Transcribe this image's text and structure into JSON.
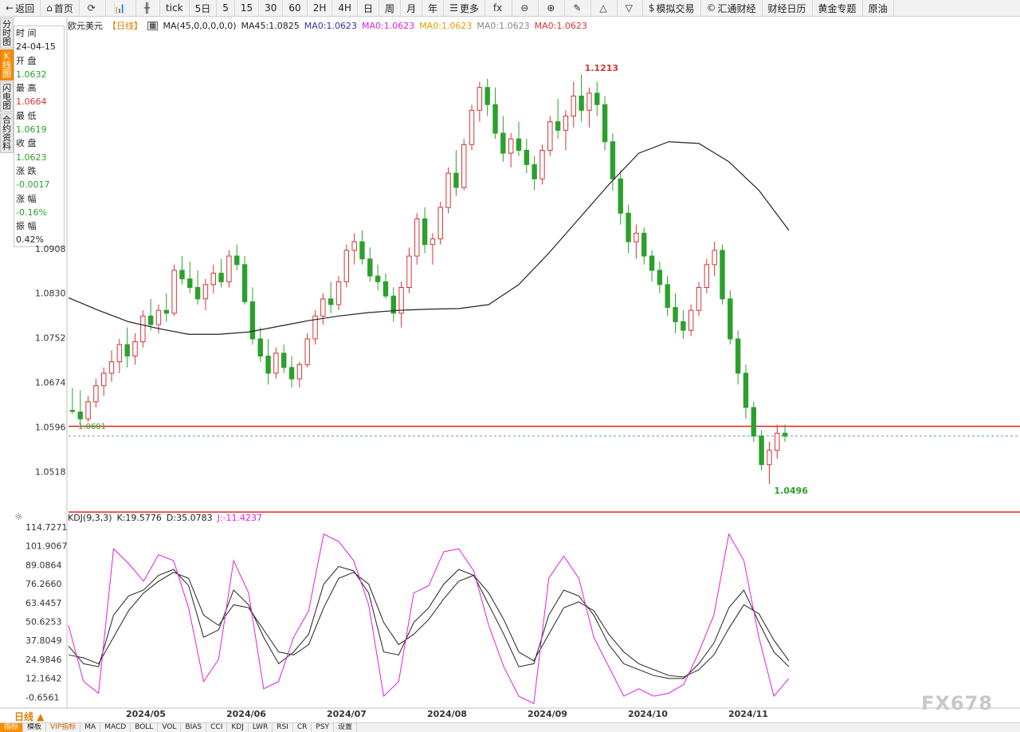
{
  "toolbar": [
    {
      "name": "back-button",
      "icon": "←",
      "label": "返回"
    },
    {
      "name": "home-button",
      "icon": "⌂",
      "label": "首页"
    },
    {
      "name": "refresh-button",
      "icon": "⟳",
      "label": ""
    },
    {
      "name": "chart-type-button",
      "icon": "📊",
      "label": ""
    },
    {
      "name": "candle-type-button",
      "icon": "╫",
      "label": ""
    },
    {
      "name": "period-tick",
      "icon": "",
      "label": "tick"
    },
    {
      "name": "period-5day",
      "icon": "",
      "label": "5日"
    },
    {
      "name": "period-5",
      "icon": "",
      "label": "5"
    },
    {
      "name": "period-15",
      "icon": "",
      "label": "15"
    },
    {
      "name": "period-30",
      "icon": "",
      "label": "30"
    },
    {
      "name": "period-60",
      "icon": "",
      "label": "60"
    },
    {
      "name": "period-2h",
      "icon": "",
      "label": "2H"
    },
    {
      "name": "period-4h",
      "icon": "",
      "label": "4H"
    },
    {
      "name": "period-day",
      "icon": "",
      "label": "日"
    },
    {
      "name": "period-week",
      "icon": "",
      "label": "周"
    },
    {
      "name": "period-month",
      "icon": "",
      "label": "月"
    },
    {
      "name": "period-year",
      "icon": "",
      "label": "年"
    },
    {
      "name": "more-button",
      "icon": "☰",
      "label": "更多"
    },
    {
      "name": "formula-button",
      "icon": "fx",
      "label": ""
    },
    {
      "name": "zoom-out-button",
      "icon": "⊖",
      "label": ""
    },
    {
      "name": "zoom-in-button",
      "icon": "⊕",
      "label": ""
    },
    {
      "name": "draw-button",
      "icon": "✎",
      "label": ""
    },
    {
      "name": "triangle-up-button",
      "icon": "△",
      "label": ""
    },
    {
      "name": "triangle-down-button",
      "icon": "▽",
      "label": ""
    },
    {
      "name": "sim-trade-button",
      "icon": "$",
      "label": "模拟交易"
    },
    {
      "name": "huitong-button",
      "icon": "©",
      "label": "汇通财经"
    },
    {
      "name": "calendar-button",
      "icon": "",
      "label": "财经日历"
    },
    {
      "name": "gold-topic-button",
      "icon": "",
      "label": "黄金专题"
    },
    {
      "name": "crude-button",
      "icon": "",
      "label": "原油"
    }
  ],
  "sidetabs": [
    {
      "name": "tab-timeshare",
      "label": "分时图",
      "active": false
    },
    {
      "name": "tab-kline",
      "label": "K线图",
      "active": true
    },
    {
      "name": "tab-flash",
      "label": "闪电图",
      "active": false
    },
    {
      "name": "tab-contract",
      "label": "合约资料",
      "active": false
    }
  ],
  "info": {
    "time_label": "时 间",
    "time_value": "24-04-15",
    "open_label": "开 盘",
    "open_value": "1.0632",
    "high_label": "最 高",
    "high_value": "1.0664",
    "low_label": "最 低",
    "low_value": "1.0619",
    "close_label": "收 盘",
    "close_value": "1.0623",
    "change_label": "涨 跌",
    "change_value": "-0.0017",
    "pct_label": "涨 幅",
    "pct_value": "-0.16%",
    "amp_label": "振 幅",
    "amp_value": "0.42%"
  },
  "legend": {
    "symbol": "欧元美元",
    "period": "【日线】",
    "ma_params": "MA(45,0,0,0,0,0)",
    "items": [
      {
        "text": "MA45:1.0825",
        "color": "#222222"
      },
      {
        "text": "MA0:1.0623",
        "color": "#3333aa"
      },
      {
        "text": "MA0:1.0623",
        "color": "#e020e0"
      },
      {
        "text": "MA0:1.0623",
        "color": "#e0a000"
      },
      {
        "text": "MA0:1.0623",
        "color": "#888888"
      },
      {
        "text": "MA0:1.0623",
        "color": "#d23535"
      }
    ]
  },
  "kdj_legend": {
    "name": "KDJ(9,3,3)",
    "k": "K:19.5776",
    "d": "D:35.0783",
    "j": "J:-11.4237",
    "k_color": "#222222",
    "d_color": "#222222",
    "j_color": "#e020e0"
  },
  "chart_data": [
    {
      "type": "candlestick",
      "title": "欧元美元 日线",
      "x_labels": [
        "2024/05",
        "2024/06",
        "2024/07",
        "2024/08",
        "2024/09",
        "2024/10",
        "2024/11"
      ],
      "y_ticks": [
        "1.0908",
        "1.0830",
        "1.0752",
        "1.0674",
        "1.0596",
        "1.0518"
      ],
      "ylim": [
        1.045,
        1.129
      ],
      "annotations": {
        "high": "1.1213",
        "low": "1.0496",
        "start_low": "1.0601"
      },
      "hlines": [
        1.0597,
        1.0447
      ],
      "current_price": 1.058,
      "up_color": "#d23535",
      "down_color": "#2ca02c",
      "series": [
        {
          "name": "MA45",
          "values": [
            1.0822,
            1.08,
            1.078,
            1.0768,
            1.0758,
            1.0758,
            1.0762,
            1.0772,
            1.0782,
            1.079,
            1.0796,
            1.08,
            1.0802,
            1.0803,
            1.081,
            1.0845,
            1.09,
            1.096,
            1.102,
            1.1075,
            1.1095,
            1.1092,
            1.106,
            1.101,
            1.094
          ]
        }
      ],
      "ohlc": [
        [
          1.0625,
          1.0664,
          1.0619,
          1.0623
        ],
        [
          1.0622,
          1.066,
          1.06,
          1.061
        ],
        [
          1.061,
          1.065,
          1.0605,
          1.064
        ],
        [
          1.064,
          1.068,
          1.063,
          1.0668
        ],
        [
          1.0668,
          1.07,
          1.065,
          1.069
        ],
        [
          1.069,
          1.073,
          1.0675,
          1.071
        ],
        [
          1.071,
          1.075,
          1.069,
          1.074
        ],
        [
          1.074,
          1.077,
          1.07,
          1.072
        ],
        [
          1.072,
          1.076,
          1.0705,
          1.0745
        ],
        [
          1.0745,
          1.08,
          1.0735,
          1.079
        ],
        [
          1.079,
          1.082,
          1.0765,
          1.0775
        ],
        [
          1.0775,
          1.081,
          1.076,
          1.08
        ],
        [
          1.08,
          1.083,
          1.078,
          1.0795
        ],
        [
          1.0795,
          1.088,
          1.079,
          1.087
        ],
        [
          1.087,
          1.0895,
          1.0845,
          1.0855
        ],
        [
          1.0855,
          1.0885,
          1.083,
          1.084
        ],
        [
          1.084,
          1.087,
          1.081,
          1.082
        ],
        [
          1.082,
          1.0855,
          1.08,
          1.0845
        ],
        [
          1.0845,
          1.088,
          1.083,
          1.0865
        ],
        [
          1.0865,
          1.089,
          1.084,
          1.085
        ],
        [
          1.085,
          1.0905,
          1.084,
          1.0895
        ],
        [
          1.0895,
          1.0915,
          1.087,
          1.088
        ],
        [
          1.088,
          1.0895,
          1.081,
          1.0815
        ],
        [
          1.0815,
          1.084,
          1.074,
          1.075
        ],
        [
          1.075,
          1.077,
          1.071,
          1.072
        ],
        [
          1.072,
          1.075,
          1.067,
          1.069
        ],
        [
          1.069,
          1.0735,
          1.068,
          1.0725
        ],
        [
          1.0725,
          1.074,
          1.069,
          1.07
        ],
        [
          1.07,
          1.072,
          1.0665,
          1.068
        ],
        [
          1.068,
          1.071,
          1.0665,
          1.0705
        ],
        [
          1.0705,
          1.076,
          1.07,
          1.075
        ],
        [
          1.075,
          1.08,
          1.074,
          1.079
        ],
        [
          1.079,
          1.083,
          1.0775,
          1.082
        ],
        [
          1.082,
          1.085,
          1.0795,
          1.081
        ],
        [
          1.081,
          1.086,
          1.08,
          1.085
        ],
        [
          1.085,
          1.0915,
          1.084,
          1.0905
        ],
        [
          1.0905,
          1.0935,
          1.088,
          1.092
        ],
        [
          1.092,
          1.094,
          1.088,
          1.089
        ],
        [
          1.089,
          1.091,
          1.085,
          1.086
        ],
        [
          1.086,
          1.088,
          1.0835,
          1.085
        ],
        [
          1.085,
          1.0865,
          1.082,
          1.0825
        ],
        [
          1.0825,
          1.084,
          1.078,
          1.0795
        ],
        [
          1.0795,
          1.085,
          1.077,
          1.084
        ],
        [
          1.084,
          1.091,
          1.083,
          1.0895
        ],
        [
          1.0895,
          1.097,
          1.088,
          1.096
        ],
        [
          1.096,
          1.098,
          1.09,
          1.0915
        ],
        [
          1.0915,
          1.0935,
          1.088,
          1.0925
        ],
        [
          1.0925,
          1.099,
          1.0915,
          1.098
        ],
        [
          1.098,
          1.105,
          1.097,
          1.104
        ],
        [
          1.104,
          1.108,
          1.1,
          1.1015
        ],
        [
          1.1015,
          1.11,
          1.101,
          1.109
        ],
        [
          1.109,
          1.116,
          1.108,
          1.115
        ],
        [
          1.115,
          1.12,
          1.113,
          1.119
        ],
        [
          1.119,
          1.1205,
          1.114,
          1.116
        ],
        [
          1.116,
          1.119,
          1.11,
          1.111
        ],
        [
          1.111,
          1.114,
          1.106,
          1.1075
        ],
        [
          1.1075,
          1.111,
          1.105,
          1.11
        ],
        [
          1.11,
          1.113,
          1.107,
          1.108
        ],
        [
          1.108,
          1.11,
          1.104,
          1.1055
        ],
        [
          1.1055,
          1.107,
          1.101,
          1.103
        ],
        [
          1.103,
          1.109,
          1.102,
          1.108
        ],
        [
          1.108,
          1.114,
          1.107,
          1.113
        ],
        [
          1.113,
          1.117,
          1.11,
          1.1115
        ],
        [
          1.1115,
          1.115,
          1.108,
          1.114
        ],
        [
          1.114,
          1.12,
          1.112,
          1.1175
        ],
        [
          1.1175,
          1.1213,
          1.113,
          1.115
        ],
        [
          1.115,
          1.119,
          1.112,
          1.118
        ],
        [
          1.118,
          1.12,
          1.114,
          1.116
        ],
        [
          1.116,
          1.1175,
          1.108,
          1.1095
        ],
        [
          1.1095,
          1.111,
          1.101,
          1.103
        ],
        [
          1.103,
          1.1045,
          1.095,
          1.097
        ],
        [
          1.097,
          1.0985,
          1.09,
          1.092
        ],
        [
          1.092,
          1.095,
          1.089,
          1.0935
        ],
        [
          1.0935,
          1.0945,
          1.088,
          1.0895
        ],
        [
          1.0895,
          1.0905,
          1.085,
          1.087
        ],
        [
          1.087,
          1.0885,
          1.083,
          1.0845
        ],
        [
          1.0845,
          1.086,
          1.079,
          1.0805
        ],
        [
          1.0805,
          1.083,
          1.076,
          1.078
        ],
        [
          1.078,
          1.08,
          1.075,
          1.0765
        ],
        [
          1.0765,
          1.081,
          1.0755,
          1.08
        ],
        [
          1.08,
          1.085,
          1.079,
          1.084
        ],
        [
          1.084,
          1.089,
          1.083,
          1.088
        ],
        [
          1.088,
          1.092,
          1.086,
          1.0905
        ],
        [
          1.0905,
          1.0915,
          1.081,
          1.082
        ],
        [
          1.082,
          1.0835,
          1.074,
          1.075
        ],
        [
          1.075,
          1.0765,
          1.067,
          1.069
        ],
        [
          1.069,
          1.0705,
          1.061,
          1.063
        ],
        [
          1.063,
          1.064,
          1.057,
          1.058
        ],
        [
          1.058,
          1.059,
          1.052,
          1.053
        ],
        [
          1.053,
          1.057,
          1.0496,
          1.0555
        ],
        [
          1.0555,
          1.06,
          1.054,
          1.0585
        ],
        [
          1.0585,
          1.06,
          1.057,
          1.058
        ]
      ]
    },
    {
      "type": "line",
      "title": "KDJ(9,3,3)",
      "y_ticks": [
        "114.7271",
        "101.9067",
        "89.0864",
        "76.2660",
        "63.4457",
        "50.6253",
        "37.8049",
        "24.9846",
        "12.1642",
        "-0.6561"
      ],
      "ylim": [
        -7.0,
        118.0
      ],
      "series": [
        {
          "name": "K",
          "values": [
            34,
            22,
            20,
            55,
            68,
            72,
            82,
            86,
            75,
            40,
            45,
            72,
            62,
            40,
            22,
            30,
            42,
            76,
            88,
            85,
            70,
            30,
            28,
            50,
            60,
            76,
            86,
            82,
            62,
            42,
            20,
            22,
            55,
            72,
            68,
            55,
            35,
            22,
            18,
            14,
            12,
            12,
            22,
            36,
            60,
            72,
            50,
            30,
            20
          ]
        },
        {
          "name": "D",
          "values": [
            28,
            26,
            22,
            40,
            58,
            70,
            78,
            84,
            80,
            55,
            48,
            62,
            60,
            45,
            30,
            28,
            35,
            60,
            80,
            84,
            76,
            50,
            35,
            42,
            52,
            66,
            78,
            82,
            70,
            52,
            30,
            24,
            42,
            60,
            64,
            58,
            42,
            30,
            22,
            18,
            14,
            13,
            18,
            28,
            46,
            62,
            56,
            38,
            24
          ]
        },
        {
          "name": "J",
          "values": [
            48,
            10,
            2,
            100,
            90,
            78,
            96,
            92,
            60,
            10,
            25,
            92,
            70,
            5,
            10,
            40,
            58,
            110,
            105,
            92,
            62,
            0,
            10,
            70,
            75,
            98,
            100,
            85,
            48,
            20,
            0,
            -5,
            80,
            95,
            80,
            40,
            20,
            0,
            5,
            0,
            2,
            8,
            30,
            55,
            110,
            92,
            40,
            0,
            12
          ]
        }
      ]
    }
  ],
  "bottom_tabs": [
    {
      "label": "指标",
      "active": true
    },
    {
      "label": "模板",
      "active": false
    },
    {
      "label": "VIP指标",
      "active": false,
      "sel": true
    },
    {
      "label": "MA"
    },
    {
      "label": "MACD"
    },
    {
      "label": "BOLL"
    },
    {
      "label": "VOL"
    },
    {
      "label": "BIAS"
    },
    {
      "label": "CCI"
    },
    {
      "label": "KDJ"
    },
    {
      "label": "LWR"
    },
    {
      "label": "RSI"
    },
    {
      "label": "CR"
    },
    {
      "label": "PSY"
    },
    {
      "label": "设置"
    }
  ],
  "period_selector": "日线 ▲",
  "watermark": "FX678"
}
